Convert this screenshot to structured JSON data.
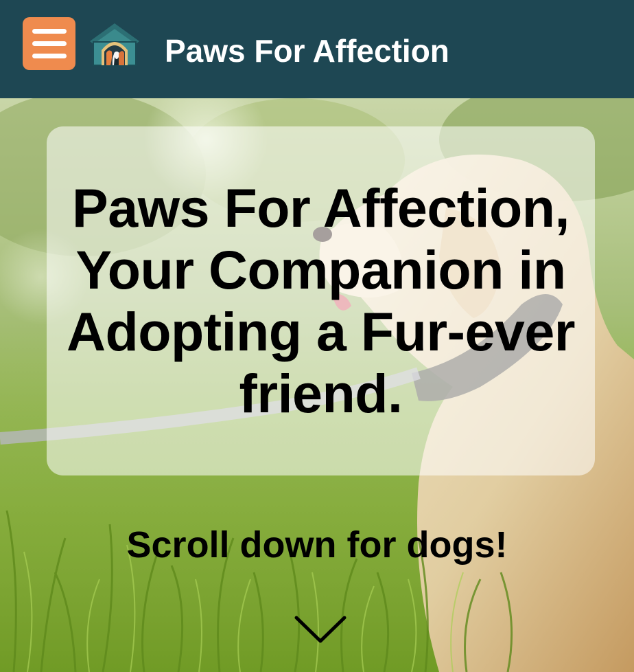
{
  "header": {
    "menu_icon": "hamburger-menu-icon",
    "logo_icon": "dog-house-logo-icon",
    "title": "Paws For Affection",
    "background_color": "#1e4753",
    "menu_button_color": "#ef8b4e"
  },
  "hero": {
    "background_image": "golden-retriever-on-leash-in-grass",
    "headline": "Paws For Affection, Your Companion in Adopting a Fur-ever friend.",
    "scroll_hint": "Scroll down for dogs!",
    "scroll_icon": "chevron-down-icon"
  }
}
